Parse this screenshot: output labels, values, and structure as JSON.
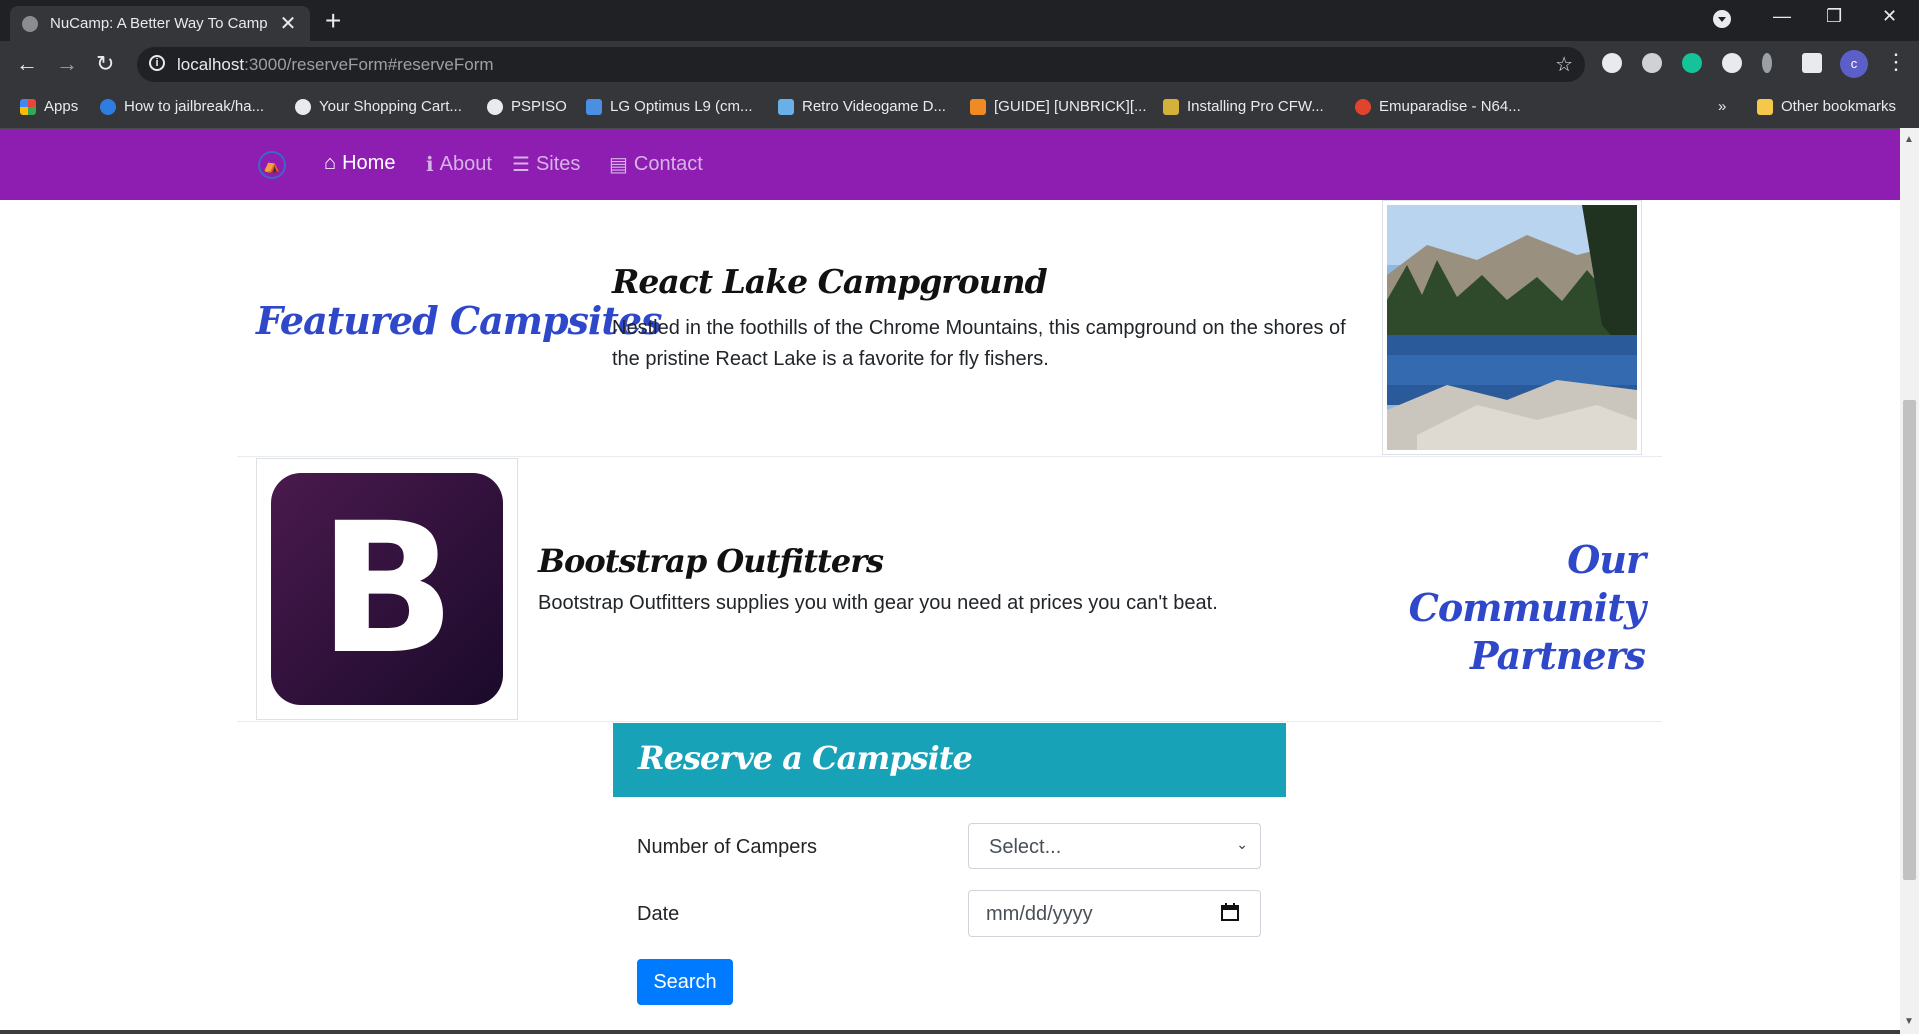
{
  "browser": {
    "tab_title": "NuCamp: A Better Way To Camp",
    "tab_close": "✕",
    "new_tab": "+",
    "url_host": "localhost",
    "url_rest": ":3000/reserveForm#reserveForm",
    "profile_initial": "c",
    "bookmarks": [
      {
        "label": "Apps",
        "color": "#e8453c"
      },
      {
        "label": "How to jailbreak/ha...",
        "color": "#2f7de1"
      },
      {
        "label": "Your Shopping Cart...",
        "color": "#e8eaed"
      },
      {
        "label": "PSPISO",
        "color": "#e8eaed"
      },
      {
        "label": "LG Optimus L9 (cm...",
        "color": "#4a90e2"
      },
      {
        "label": "Retro Videogame D...",
        "color": "#6ab0e8"
      },
      {
        "label": "[GUIDE] [UNBRICK][...",
        "color": "#f08a24"
      },
      {
        "label": "Installing Pro CFW...",
        "color": "#d4b13a"
      },
      {
        "label": "Emuparadise - N64...",
        "color": "#e0452b"
      }
    ],
    "bookmarks_overflow": "»",
    "other_bookmarks": "Other bookmarks"
  },
  "navbar": {
    "items": [
      {
        "label": "Home",
        "icon": "home-icon",
        "glyph": "⌂"
      },
      {
        "label": "About",
        "icon": "info-icon",
        "glyph": "ℹ"
      },
      {
        "label": "Sites",
        "icon": "list-icon",
        "glyph": "☰"
      },
      {
        "label": "Contact",
        "icon": "address-card-icon",
        "glyph": "▤"
      }
    ],
    "color": "#8e1eb2"
  },
  "featured": {
    "heading": "Featured Campsites",
    "title": "React Lake Campground",
    "description": "Nestled in the foothills of the Chrome Mountains, this campground on the shores of the pristine React Lake is a favorite for fly fishers."
  },
  "partner": {
    "logo_letter": "B",
    "title": "Bootstrap Outfitters",
    "description": "Bootstrap Outfitters supplies you with gear you need at prices you can't beat.",
    "heading_line1": "Our Community",
    "heading_line2": "Partners"
  },
  "reserve": {
    "title": "Reserve a Campsite",
    "campers_label": "Number of Campers",
    "campers_value": "Select...",
    "date_label": "Date",
    "date_placeholder": "mm/dd/yyyy",
    "search_label": "Search",
    "header_color": "#17a2b8",
    "button_color": "#007bff"
  }
}
